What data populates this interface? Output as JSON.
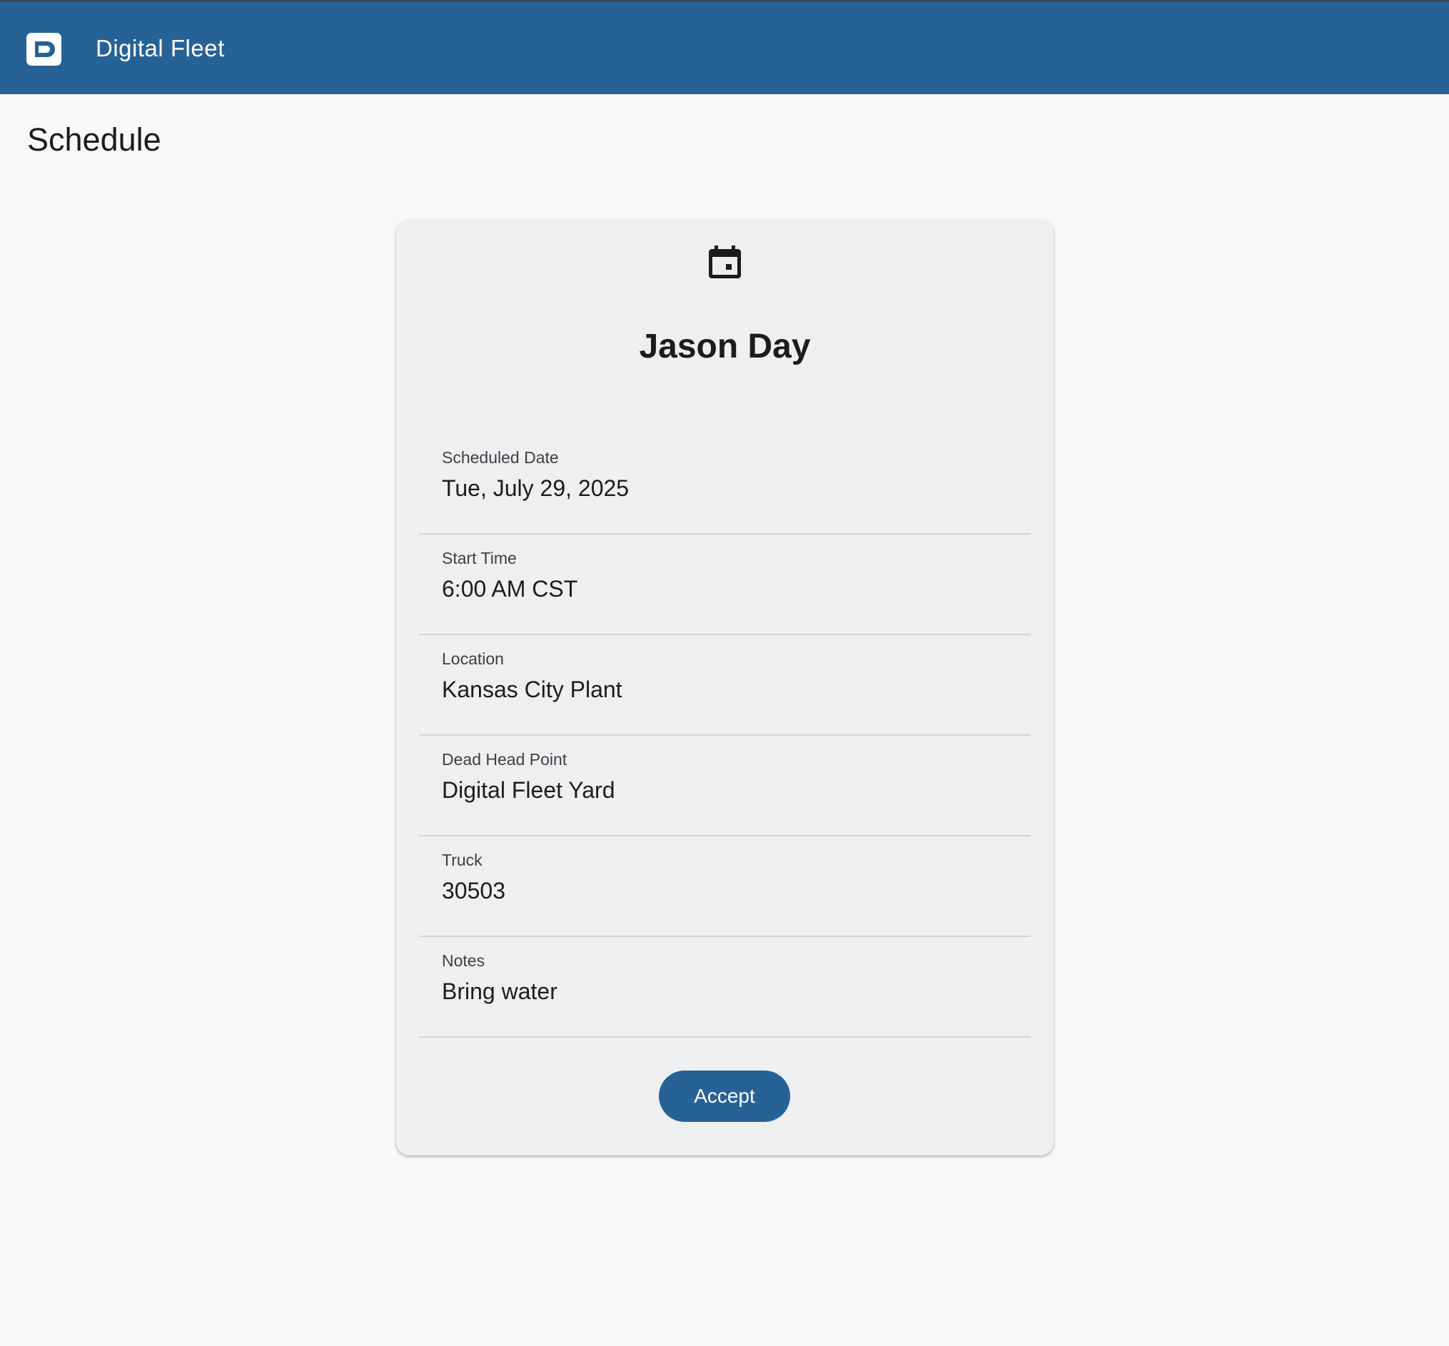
{
  "header": {
    "app_name": "Digital Fleet",
    "logo_icon": "digital-fleet-logo-icon",
    "bar_color": "#276296"
  },
  "page": {
    "title": "Schedule"
  },
  "card": {
    "icon": "calendar-icon",
    "name": "Jason Day",
    "fields": [
      {
        "label": "Scheduled Date",
        "value": "Tue, July 29, 2025"
      },
      {
        "label": "Start Time",
        "value": "6:00 AM CST"
      },
      {
        "label": "Location",
        "value": "Kansas City Plant"
      },
      {
        "label": "Dead Head Point",
        "value": "Digital Fleet Yard"
      },
      {
        "label": "Truck",
        "value": "30503"
      },
      {
        "label": "Notes",
        "value": "Bring water"
      }
    ],
    "accept_label": "Accept",
    "accent_color": "#276296"
  }
}
